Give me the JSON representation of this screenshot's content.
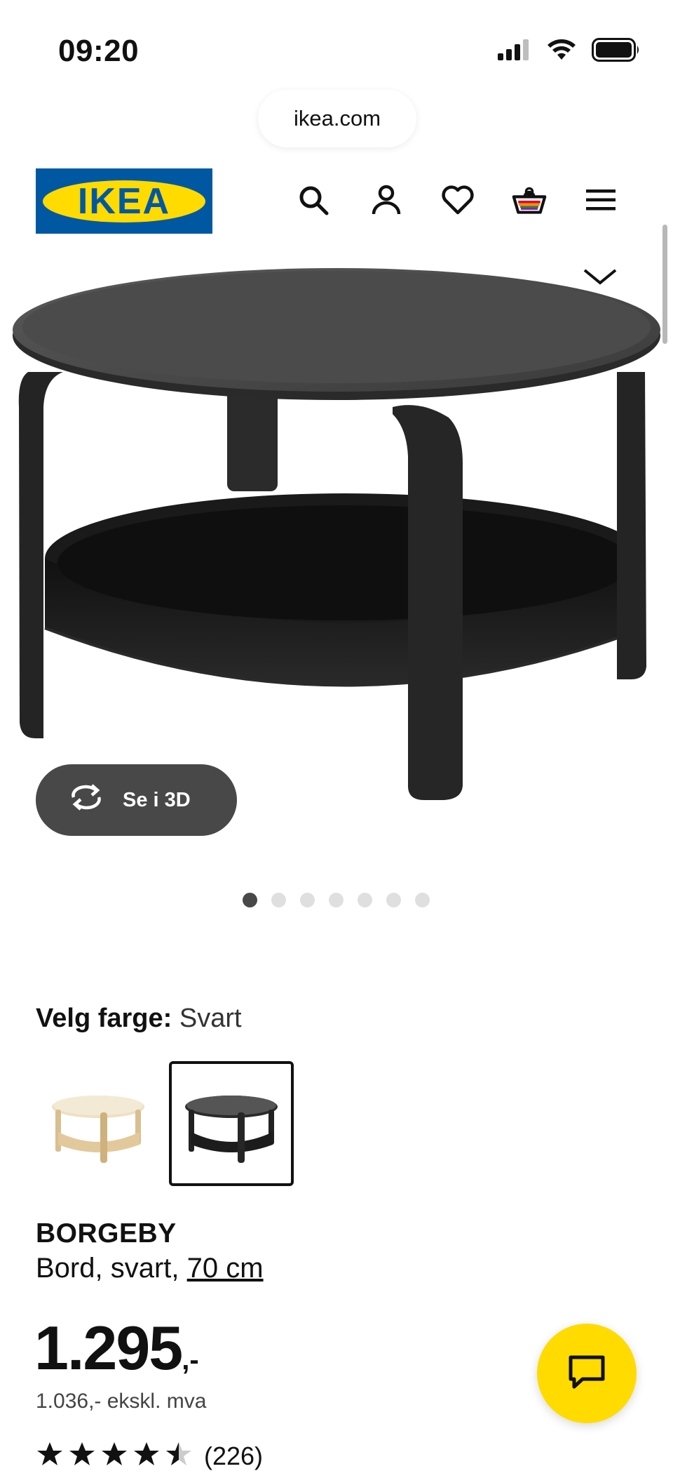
{
  "status_bar": {
    "time": "09:20"
  },
  "browser": {
    "url": "ikea.com"
  },
  "header": {
    "logo_text": "IKEA",
    "icons": [
      "search-icon",
      "account-icon",
      "heart-icon",
      "cart-icon",
      "menu-icon"
    ]
  },
  "hero": {
    "view_3d_label": "Se i 3D",
    "carousel_count": 7,
    "carousel_active": 0
  },
  "product": {
    "color_label": "Velg farge:",
    "color_value": "Svart",
    "swatches": [
      {
        "name": "birch",
        "selected": false
      },
      {
        "name": "black",
        "selected": true
      }
    ],
    "name": "BORGEBY",
    "description_prefix": "Bord, svart,",
    "size_link": "70 cm",
    "price_main": "1.295",
    "price_suffix": ",-",
    "price_ex_vat": "1.036,- ekskl. mva",
    "rating_stars": 4.5,
    "rating_count": "(226)"
  },
  "colors": {
    "ikea_blue": "#0058a3",
    "ikea_yellow": "#ffdb00",
    "dark_button": "#484848"
  }
}
